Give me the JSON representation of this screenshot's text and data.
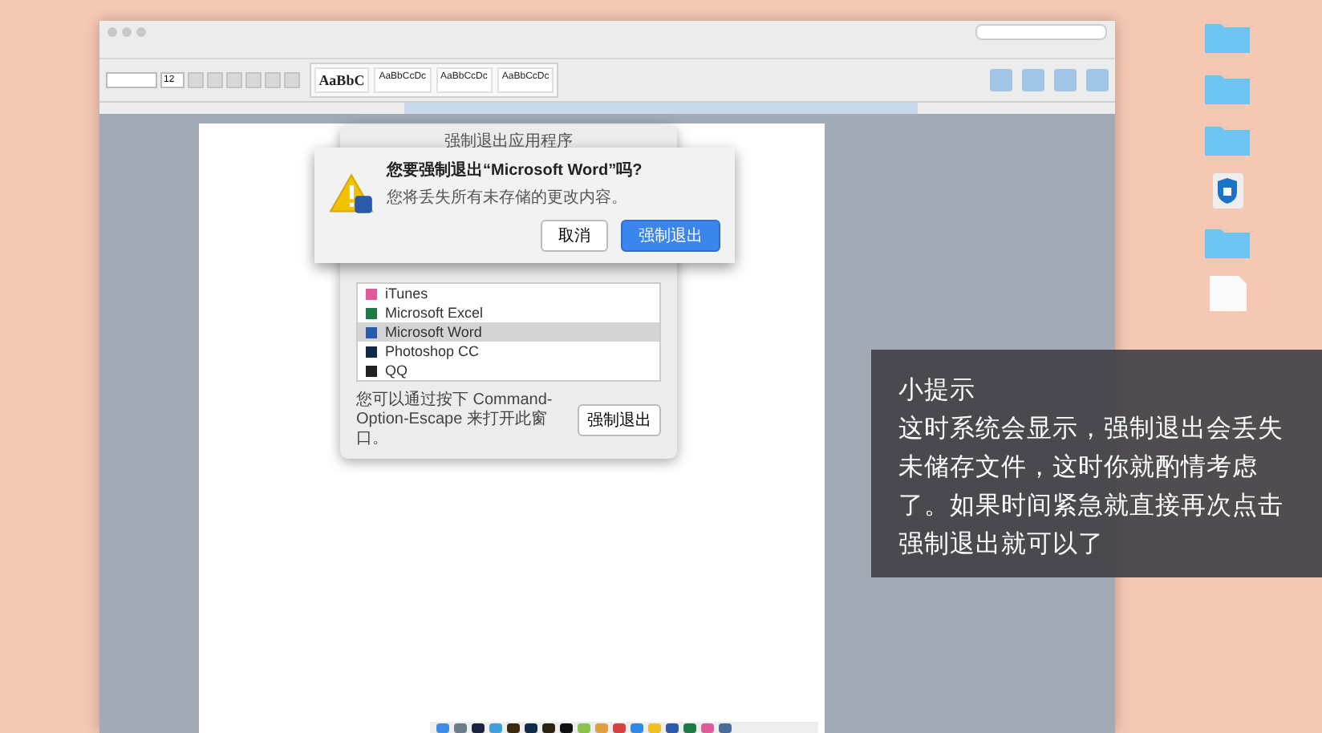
{
  "word_window": {
    "font_size": "12",
    "styles": [
      {
        "sample": "AaBbC",
        "large": true
      },
      {
        "sample": "AaBbCcDc",
        "large": false
      },
      {
        "sample": "AaBbCcDc",
        "large": false
      },
      {
        "sample": "AaBbCcDc",
        "large": false
      }
    ]
  },
  "force_quit_window": {
    "title": "强制退出应用程序",
    "apps": [
      {
        "name": "iTunes",
        "color": "#e05a9a",
        "selected": false
      },
      {
        "name": "Microsoft Excel",
        "color": "#1e7a45",
        "selected": false
      },
      {
        "name": "Microsoft Word",
        "color": "#2b5aa8",
        "selected": true
      },
      {
        "name": "Photoshop CC",
        "color": "#0f2a4a",
        "selected": false
      },
      {
        "name": "QQ",
        "color": "#222222",
        "selected": false
      }
    ],
    "hint": "您可以通过按下 Command-Option-Escape 来打开此窗口。",
    "button": "强制退出"
  },
  "alert": {
    "question": "您要强制退出“Microsoft Word”吗?",
    "message": "您将丢失所有未存储的更改内容。",
    "cancel": "取消",
    "confirm": "强制退出"
  },
  "tip": {
    "title": "小提示",
    "body": "这时系统会显示，强制退出会丢失未储存文件，这时你就酌情考虑了。如果时间紧急就直接再次点击强制退出就可以了"
  },
  "desktop_icons": [
    {
      "kind": "folder"
    },
    {
      "kind": "folder"
    },
    {
      "kind": "folder"
    },
    {
      "kind": "app"
    },
    {
      "kind": "folder"
    },
    {
      "kind": "file"
    }
  ]
}
